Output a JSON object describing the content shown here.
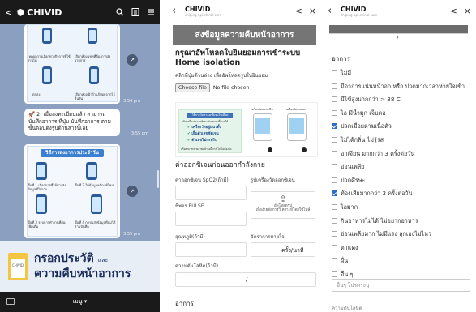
{
  "chat": {
    "back": "<",
    "name": "CHIVID",
    "icons": [
      "search-icon",
      "list-icon",
      "menu-icon"
    ],
    "bubble_label_a": "เหตุผลการเลือกห่วงกิจการที่ใช้งานได้",
    "bubble_label_b": "เลือกห้องแชทที่ต้องการส่งรายการ",
    "bubble_label_c": "ตกลง",
    "bubble_label_d": "เลือกห่วงเฝ้าถ้าแก้บ่อยจากไว้ยืนยัน",
    "time1": "3:54 pm",
    "message": "2. เมื่อลงทะเบียนแล้ว สามารถบันทึกอาการ ที่ปุ่ม บันทึกอาการ ตามขั้นตอนดังรูปด้านล่างนี้เลย",
    "time2": "3:55 pm",
    "banner": "วิธีการส่งอาการประจำวัน",
    "sub_a": "ขั้นที่ 1 เลือกการที่ให้ห่วงส่งข้อมูลที่ใช้งาน",
    "sub_b": "ขั้นที่ 2 ให้ข้อมูลคลิกแพ้ใหม่",
    "sub_c": "ขั้นที่ 3 ระบุการทำงานที่ต้องเพิ่มเติม",
    "sub_d": "ขั้นที่ 4 กดปุ่มส่งข้อมูลที่ปุ่มได้สามบันทึก",
    "time3": "3:55 pm",
    "cta_line1": "กรอกประวัติ",
    "cta_and": "และ",
    "cta_line2": "ความคืบหน้าอาการ",
    "cta_icon_text": "CHIVID",
    "menu": "เมนู ▾"
  },
  "browser": {
    "title": "CHIVID",
    "url": "chiping-api.chinal.com",
    "share": "<",
    "close": "×"
  },
  "form": {
    "header": "ส่งข้อมูลความคืบหน้าอาการ",
    "upload_title_1": "กรุณาอัพโหลดใบยินยอมการเข้าระบบ",
    "upload_title_2": "Home isolation",
    "instruction": "คลิกที่ปุ่มด้านล่าง เพื่ออัพโหลดรูปใบยินยอม",
    "choose_file": "Choose file",
    "no_file": "No file chosen",
    "promo_head": "วิธีการวัดค่าออกซิเจนในเลือด",
    "promo_sub": "เปิดเครื่องวัดออกซิเจน ตัวเลขจะขึ้นมาให้",
    "promo_checks": [
      "เครื่องวัดอยู่แนวตั้ง",
      "เย็นตัวเลขชัดเจน",
      "ตัวเลขไม่กะพริบ"
    ],
    "promo_foot": "หรือสามารถถ่ายภาพหน้าจอนี้ กรณีไม่มีเครื่องวัด",
    "dev1": "เครื่องวัดแบบหนีบ",
    "dev2": "เครื่องวัดแบบยกแขน",
    "vitals_heading": "ค่าออกซิเจนก่อนออกกำลังกาย",
    "spo2_label": "ค่าออกซิเจน SpO2(ถ้ามี)",
    "photo_label": "รูปเครื่องวัดออกซิเจน",
    "pulse_label": "ชีพจร PULSE",
    "upload_hint_1": "อัพโหลดรูป",
    "upload_hint_2": "เพื่อง่ายต่อการวิเคราะห์โดยใช้ไฟล์",
    "temp_label": "อุณหภูมิ(ถ้ามี)",
    "resp_label": "อัตราการหายใจ",
    "resp_unit": "ครั้ง/นาที",
    "bp_label": "ความดันโลหิต(ถ้ามี)",
    "bp_sep": "/",
    "symptoms_label": "อาการ"
  },
  "symptoms": {
    "sep": "/",
    "heading": "อาการ",
    "options": [
      {
        "label": "ไม่มี",
        "checked": false
      },
      {
        "label": "มีอาการแน่นหน้าอก หรือ ปวดมากเวลาหายใจเข้า",
        "checked": false
      },
      {
        "label": "มีไข้สูงมากกว่า > 38 C",
        "checked": false
      },
      {
        "label": "ไอ มีน้ำมูก เจ็บคอ",
        "checked": false
      },
      {
        "label": "ปวดเมื่อยตามเนื้อตัว",
        "checked": true
      },
      {
        "label": "ไม่ได้กลิ่น ไม่รู้รส",
        "checked": false
      },
      {
        "label": "อาเจียน มากกว่า 3 ครั้งต่อวัน",
        "checked": false
      },
      {
        "label": "อ่อนเพลีย",
        "checked": false
      },
      {
        "label": "ปวดศีรษะ",
        "checked": false
      },
      {
        "label": "ท้องเสียมากกว่า 3 ครั้งต่อวัน",
        "checked": true
      },
      {
        "label": "ไอมาก",
        "checked": false
      },
      {
        "label": "กินอาหารไม่ได้ ไม่อยากอาหาร",
        "checked": false
      },
      {
        "label": "อ่อนเพลียมาก ไม่มีแรง ลุกเองไม่ไหว",
        "checked": false
      },
      {
        "label": "ตาแดง",
        "checked": false
      },
      {
        "label": "ผื่น",
        "checked": false
      },
      {
        "label": "อื่น ๆ",
        "checked": false
      }
    ],
    "other_placeholder": "อื่นๆ โปรดระบุ",
    "footer": "ความดันโลหิต"
  }
}
